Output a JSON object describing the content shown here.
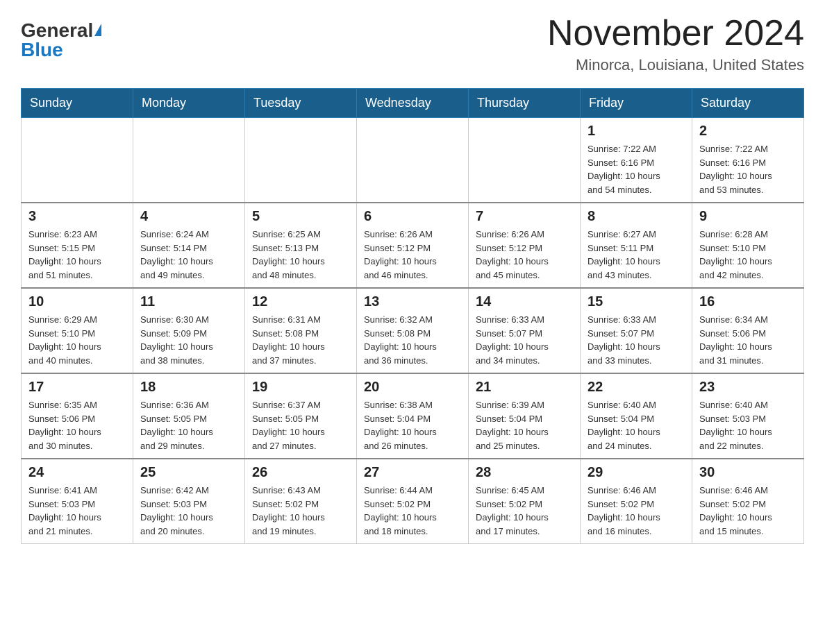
{
  "header": {
    "logo_general": "General",
    "logo_blue": "Blue",
    "title": "November 2024",
    "subtitle": "Minorca, Louisiana, United States"
  },
  "days_of_week": [
    "Sunday",
    "Monday",
    "Tuesday",
    "Wednesday",
    "Thursday",
    "Friday",
    "Saturday"
  ],
  "weeks": [
    [
      {
        "day": "",
        "info": ""
      },
      {
        "day": "",
        "info": ""
      },
      {
        "day": "",
        "info": ""
      },
      {
        "day": "",
        "info": ""
      },
      {
        "day": "",
        "info": ""
      },
      {
        "day": "1",
        "info": "Sunrise: 7:22 AM\nSunset: 6:16 PM\nDaylight: 10 hours\nand 54 minutes."
      },
      {
        "day": "2",
        "info": "Sunrise: 7:22 AM\nSunset: 6:16 PM\nDaylight: 10 hours\nand 53 minutes."
      }
    ],
    [
      {
        "day": "3",
        "info": "Sunrise: 6:23 AM\nSunset: 5:15 PM\nDaylight: 10 hours\nand 51 minutes."
      },
      {
        "day": "4",
        "info": "Sunrise: 6:24 AM\nSunset: 5:14 PM\nDaylight: 10 hours\nand 49 minutes."
      },
      {
        "day": "5",
        "info": "Sunrise: 6:25 AM\nSunset: 5:13 PM\nDaylight: 10 hours\nand 48 minutes."
      },
      {
        "day": "6",
        "info": "Sunrise: 6:26 AM\nSunset: 5:12 PM\nDaylight: 10 hours\nand 46 minutes."
      },
      {
        "day": "7",
        "info": "Sunrise: 6:26 AM\nSunset: 5:12 PM\nDaylight: 10 hours\nand 45 minutes."
      },
      {
        "day": "8",
        "info": "Sunrise: 6:27 AM\nSunset: 5:11 PM\nDaylight: 10 hours\nand 43 minutes."
      },
      {
        "day": "9",
        "info": "Sunrise: 6:28 AM\nSunset: 5:10 PM\nDaylight: 10 hours\nand 42 minutes."
      }
    ],
    [
      {
        "day": "10",
        "info": "Sunrise: 6:29 AM\nSunset: 5:10 PM\nDaylight: 10 hours\nand 40 minutes."
      },
      {
        "day": "11",
        "info": "Sunrise: 6:30 AM\nSunset: 5:09 PM\nDaylight: 10 hours\nand 38 minutes."
      },
      {
        "day": "12",
        "info": "Sunrise: 6:31 AM\nSunset: 5:08 PM\nDaylight: 10 hours\nand 37 minutes."
      },
      {
        "day": "13",
        "info": "Sunrise: 6:32 AM\nSunset: 5:08 PM\nDaylight: 10 hours\nand 36 minutes."
      },
      {
        "day": "14",
        "info": "Sunrise: 6:33 AM\nSunset: 5:07 PM\nDaylight: 10 hours\nand 34 minutes."
      },
      {
        "day": "15",
        "info": "Sunrise: 6:33 AM\nSunset: 5:07 PM\nDaylight: 10 hours\nand 33 minutes."
      },
      {
        "day": "16",
        "info": "Sunrise: 6:34 AM\nSunset: 5:06 PM\nDaylight: 10 hours\nand 31 minutes."
      }
    ],
    [
      {
        "day": "17",
        "info": "Sunrise: 6:35 AM\nSunset: 5:06 PM\nDaylight: 10 hours\nand 30 minutes."
      },
      {
        "day": "18",
        "info": "Sunrise: 6:36 AM\nSunset: 5:05 PM\nDaylight: 10 hours\nand 29 minutes."
      },
      {
        "day": "19",
        "info": "Sunrise: 6:37 AM\nSunset: 5:05 PM\nDaylight: 10 hours\nand 27 minutes."
      },
      {
        "day": "20",
        "info": "Sunrise: 6:38 AM\nSunset: 5:04 PM\nDaylight: 10 hours\nand 26 minutes."
      },
      {
        "day": "21",
        "info": "Sunrise: 6:39 AM\nSunset: 5:04 PM\nDaylight: 10 hours\nand 25 minutes."
      },
      {
        "day": "22",
        "info": "Sunrise: 6:40 AM\nSunset: 5:04 PM\nDaylight: 10 hours\nand 24 minutes."
      },
      {
        "day": "23",
        "info": "Sunrise: 6:40 AM\nSunset: 5:03 PM\nDaylight: 10 hours\nand 22 minutes."
      }
    ],
    [
      {
        "day": "24",
        "info": "Sunrise: 6:41 AM\nSunset: 5:03 PM\nDaylight: 10 hours\nand 21 minutes."
      },
      {
        "day": "25",
        "info": "Sunrise: 6:42 AM\nSunset: 5:03 PM\nDaylight: 10 hours\nand 20 minutes."
      },
      {
        "day": "26",
        "info": "Sunrise: 6:43 AM\nSunset: 5:02 PM\nDaylight: 10 hours\nand 19 minutes."
      },
      {
        "day": "27",
        "info": "Sunrise: 6:44 AM\nSunset: 5:02 PM\nDaylight: 10 hours\nand 18 minutes."
      },
      {
        "day": "28",
        "info": "Sunrise: 6:45 AM\nSunset: 5:02 PM\nDaylight: 10 hours\nand 17 minutes."
      },
      {
        "day": "29",
        "info": "Sunrise: 6:46 AM\nSunset: 5:02 PM\nDaylight: 10 hours\nand 16 minutes."
      },
      {
        "day": "30",
        "info": "Sunrise: 6:46 AM\nSunset: 5:02 PM\nDaylight: 10 hours\nand 15 minutes."
      }
    ]
  ]
}
